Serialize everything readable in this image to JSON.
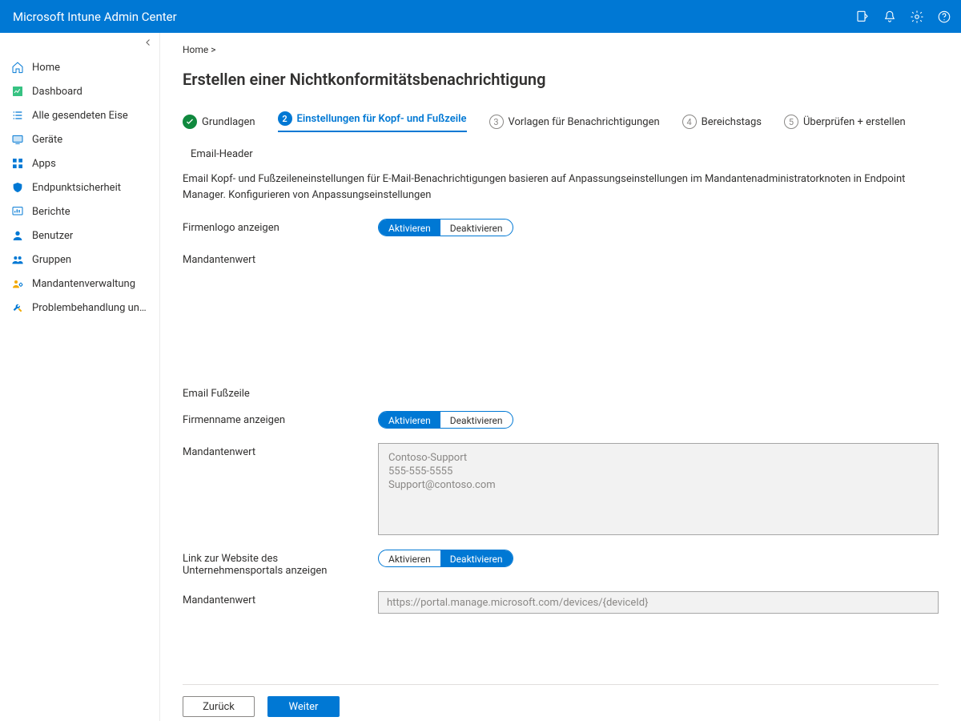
{
  "app_title": "Microsoft Intune Admin Center",
  "topbar_icons": {
    "feedback": "feedback-icon",
    "notifications": "bell-icon",
    "settings": "gear-icon",
    "help": "help-icon"
  },
  "sidebar": {
    "items": [
      {
        "id": "home",
        "label": "Home"
      },
      {
        "id": "dashboard",
        "label": "Dashboard"
      },
      {
        "id": "allservices",
        "label": "Alle gesendeten Eise"
      },
      {
        "id": "devices",
        "label": "Geräte"
      },
      {
        "id": "apps",
        "label": "Apps"
      },
      {
        "id": "endpointsec",
        "label": "Endpunktsicherheit"
      },
      {
        "id": "reports",
        "label": "Berichte"
      },
      {
        "id": "users",
        "label": "Benutzer"
      },
      {
        "id": "groups",
        "label": "Gruppen"
      },
      {
        "id": "tenantadmin",
        "label": "Mandantenverwaltung"
      },
      {
        "id": "troubleshoot",
        "label": "Problembehandlung und Support"
      }
    ]
  },
  "breadcrumb": "Home >",
  "page_title": "Erstellen einer Nichtkonformitätsbenachrichtigung",
  "steps": [
    {
      "num": "1",
      "label": "Grundlagen",
      "state": "done"
    },
    {
      "num": "2",
      "label": "Einstellungen für Kopf- und Fußzeile",
      "state": "current"
    },
    {
      "num": "3",
      "label": "Vorlagen für Benachrichtigungen",
      "state": "pending"
    },
    {
      "num": "4",
      "label": "Bereichstags",
      "state": "pending"
    },
    {
      "num": "5",
      "label": "Überprüfen + erstellen",
      "state": "pending"
    }
  ],
  "form": {
    "header_section": "Email-Header",
    "description": "Email Kopf- und Fußzeileneinstellungen für E-Mail-Benachrichtigungen basieren auf Anpassungseinstellungen im Mandantenadministratorknoten in Endpoint Manager. Konfigurieren von Anpassungseinstellungen",
    "logo_row": {
      "label": "Firmenlogo anzeigen",
      "options": {
        "on": "Aktivieren",
        "off": "Deaktivieren"
      },
      "selected": "on"
    },
    "header_tenant_label": "Mandantenwert",
    "footer_section": "Email Fußzeile",
    "company_name_row": {
      "label": "Firmenname anzeigen",
      "options": {
        "on": "Aktivieren",
        "off": "Deaktivieren"
      },
      "selected": "on"
    },
    "footer_tenant": {
      "label": "Mandantenwert",
      "lines": [
        "Contoso-Support",
        "555-555-5555",
        "Support@contoso.com"
      ]
    },
    "portal_link_row": {
      "label": "Link zur Website des Unternehmensportals anzeigen",
      "options": {
        "on": "Aktivieren",
        "off": "Deaktivieren"
      },
      "selected": "off"
    },
    "portal_tenant": {
      "label": "Mandantenwert",
      "value": "https://portal.manage.microsoft.com/devices/{deviceId}"
    }
  },
  "buttons": {
    "back": "Zurück",
    "next": "Weiter"
  }
}
